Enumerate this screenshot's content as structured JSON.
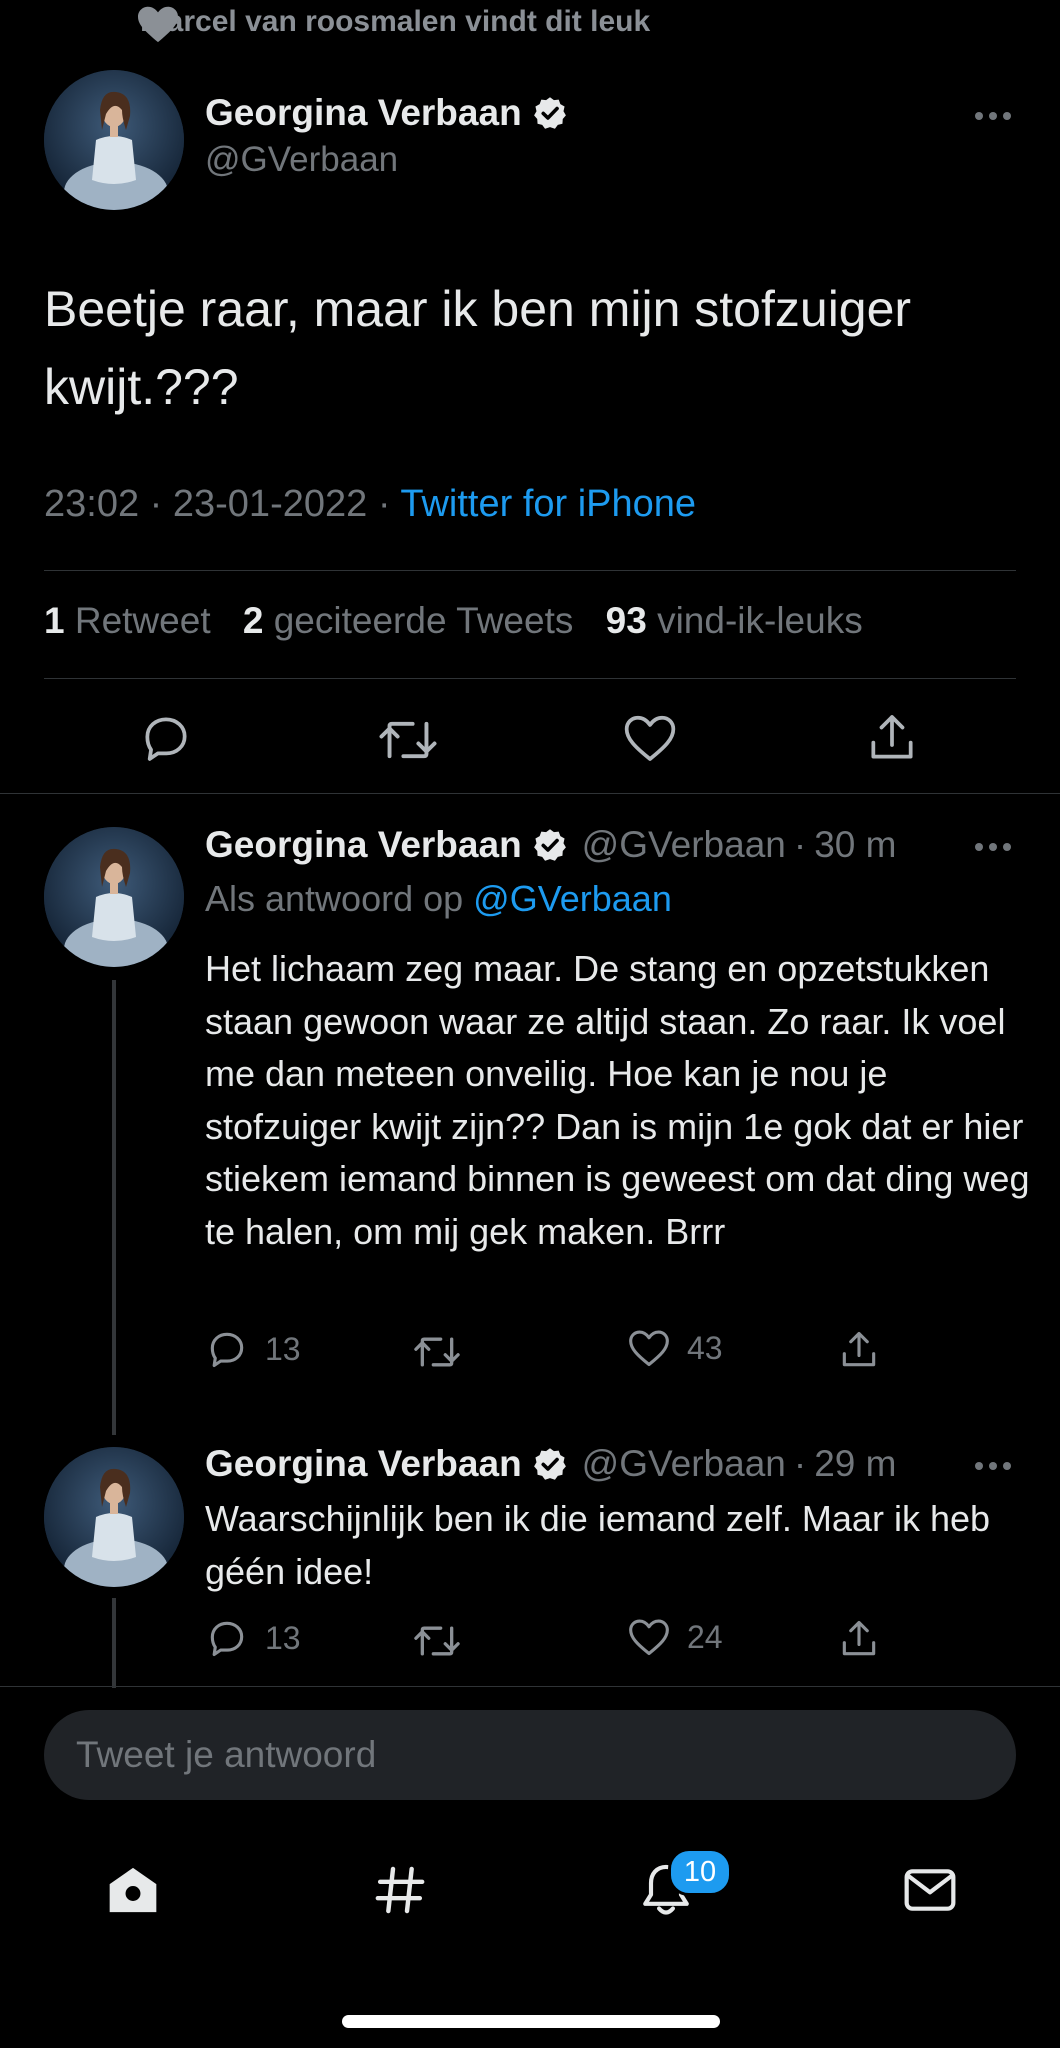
{
  "social_context": {
    "text": "marcel van roosmalen vindt dit leuk",
    "icon": "heart-icon"
  },
  "main_tweet": {
    "author_name": "Georgina Verbaan",
    "handle": "@GVerbaan",
    "text": "Beetje raar, maar ik ben mijn stofzuiger kwijt.???",
    "time": "23:02",
    "date": "23-01-2022",
    "separator": "·",
    "source": "Twitter for iPhone",
    "stats": {
      "retweets_count": "1",
      "retweets_label": "Retweet",
      "quotes_count": "2",
      "quotes_label": "geciteerde Tweets",
      "likes_count": "93",
      "likes_label": "vind-ik-leuks"
    }
  },
  "replies": [
    {
      "author_name": "Georgina Verbaan",
      "handle": "@GVerbaan",
      "time": "30 m",
      "reply_to_label": "Als antwoord op",
      "reply_to_handle": "@GVerbaan",
      "text": "Het lichaam zeg maar. De stang en opzetstukken staan gewoon waar ze altijd staan. Zo raar. Ik voel me dan meteen onveilig. Hoe kan je nou je stofzuiger kwijt zijn?? Dan is mijn 1e gok dat er hier stiekem iemand binnen is geweest om dat ding weg te halen, om mij gek maken. Brrr",
      "reply_count": "13",
      "like_count": "43"
    },
    {
      "author_name": "Georgina Verbaan",
      "handle": "@GVerbaan",
      "time": "29 m",
      "text": "Waarschijnlijk ben ik die iemand zelf. Maar ik heb géén idee!",
      "reply_count": "13",
      "like_count": "24"
    }
  ],
  "composer": {
    "placeholder": "Tweet je antwoord"
  },
  "tab_bar": {
    "items": [
      "home-icon",
      "explore-hashtag-icon",
      "notifications-bell-icon",
      "messages-envelope-icon"
    ],
    "notification_badge": "10"
  },
  "colors": {
    "background": "#000000",
    "text": "#e7e9ea",
    "muted": "#71767b",
    "accent": "#1d9bf0",
    "divider": "#2f3336"
  }
}
